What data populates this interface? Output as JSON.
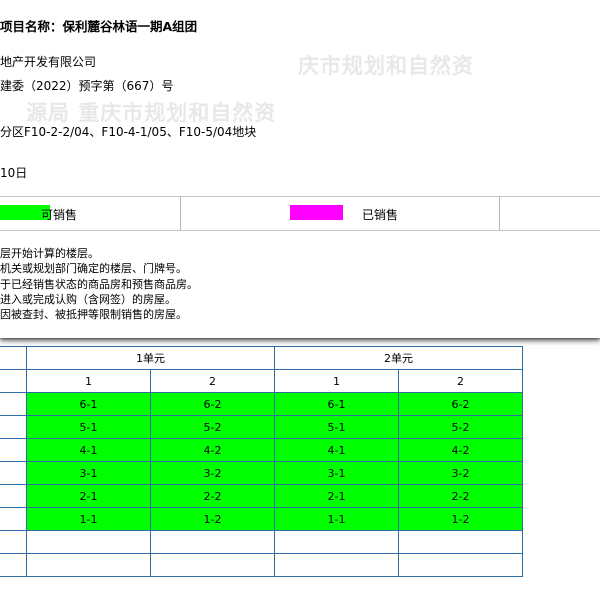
{
  "colors": {
    "available": "#00ff00",
    "sold": "#ff00ff",
    "table_border": "#2e6da4"
  },
  "info": {
    "project": "项目名称：保利麓谷林语一期A组团",
    "developer": "地产开发有限公司",
    "permit": "建委（2022）预字第（667）号",
    "plots": "分区F10-2-2/04、F10-4-1/05、F10-5/04地块",
    "date": "10日",
    "watermark_1": "庆市规划和自然资",
    "watermark_2": "源局 重庆市规划和自然资"
  },
  "legend": {
    "available_label": "可销售",
    "sold_label": "已销售"
  },
  "notes": [
    "层开始计算的楼层。",
    "机关或规划部门确定的楼层、门牌号。",
    "于已经销售状态的商品房和预售商品房。",
    "进入或完成认购（含网签）的房屋。",
    "因被查封、被抵押等限制销售的房屋。"
  ],
  "table": {
    "units": [
      "1单元",
      "2单元"
    ],
    "rooms": [
      "1",
      "2",
      "1",
      "2"
    ],
    "rows": [
      [
        "6-1",
        "6-2",
        "6-1",
        "6-2"
      ],
      [
        "5-1",
        "5-2",
        "5-1",
        "5-2"
      ],
      [
        "4-1",
        "4-2",
        "4-1",
        "4-2"
      ],
      [
        "3-1",
        "3-2",
        "3-1",
        "3-2"
      ],
      [
        "2-1",
        "2-2",
        "2-1",
        "2-2"
      ],
      [
        "1-1",
        "1-2",
        "1-1",
        "1-2"
      ]
    ]
  }
}
